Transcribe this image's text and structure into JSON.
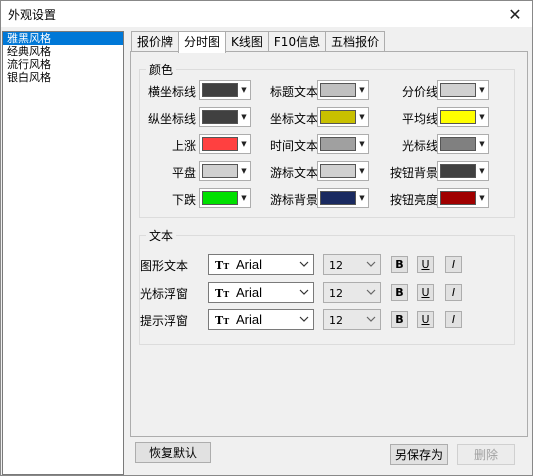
{
  "window": {
    "title": "外观设置",
    "close_glyph": "✕"
  },
  "styles": [
    "雅黑风格",
    "经典风格",
    "流行风格",
    "银白风格"
  ],
  "tabs": [
    "报价牌",
    "分时图",
    "K线图",
    "F10信息",
    "五档报价"
  ],
  "color_group": {
    "label": "颜色",
    "items": [
      {
        "label": "横坐标线",
        "color": "#404040"
      },
      {
        "label": "标题文本",
        "color": "#c0c0c0"
      },
      {
        "label": "分价线",
        "color": "#d0d0d0"
      },
      {
        "label": "纵坐标线",
        "color": "#404040"
      },
      {
        "label": "坐标文本",
        "color": "#c8c000"
      },
      {
        "label": "平均线",
        "color": "#ffff00"
      },
      {
        "label": "上涨",
        "color": "#ff4040"
      },
      {
        "label": "时间文本",
        "color": "#a0a0a0"
      },
      {
        "label": "光标线",
        "color": "#808080"
      },
      {
        "label": "平盘",
        "color": "#d0d0d0"
      },
      {
        "label": "游标文本",
        "color": "#d0d0d0"
      },
      {
        "label": "按钮背景",
        "color": "#404040"
      },
      {
        "label": "下跌",
        "color": "#00e000"
      },
      {
        "label": "游标背景",
        "color": "#1a2a60"
      },
      {
        "label": "按钮亮度",
        "color": "#a00000"
      }
    ]
  },
  "text_group": {
    "label": "文本",
    "items": [
      {
        "label": "图形文本",
        "font": "Arial",
        "size": "12"
      },
      {
        "label": "光标浮窗",
        "font": "Arial",
        "size": "12"
      },
      {
        "label": "提示浮窗",
        "font": "Arial",
        "size": "12"
      }
    ],
    "bold": "B",
    "underline": "U",
    "italic": "I"
  },
  "buttons": {
    "restore": "恢复默认",
    "save_as": "另保存为",
    "delete": "删除"
  }
}
